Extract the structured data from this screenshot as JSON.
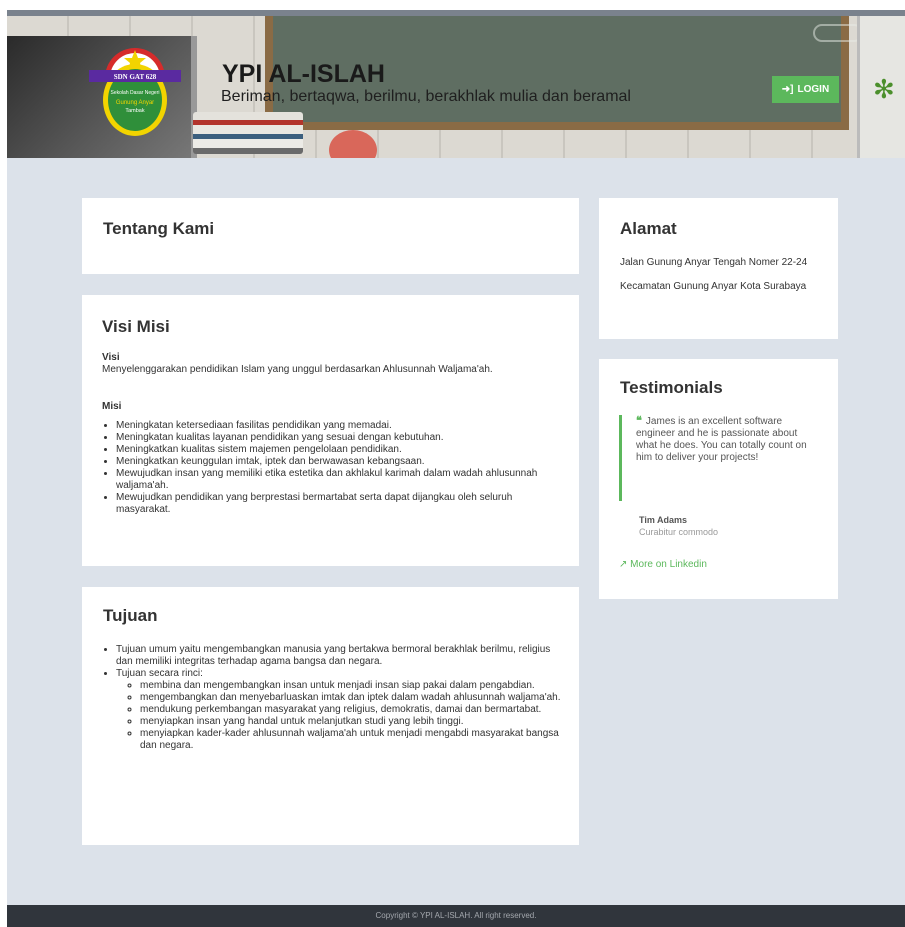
{
  "header": {
    "title": "YPI AL-ISLAH",
    "tagline": "Beriman, bertaqwa, berilmu, berakhlak mulia dan beramal",
    "login_label": "LOGIN",
    "logo": {
      "banner_text": "SDN GAT 628",
      "line1": "Sekolah Dasar Negeri",
      "line2": "Gunung Anyar",
      "line3": "Tambak"
    }
  },
  "tentang": {
    "title": "Tentang Kami"
  },
  "visi_misi": {
    "title": "Visi Misi",
    "visi_label": "Visi",
    "visi_text": "Menyelenggarakan pendidikan Islam yang unggul berdasarkan Ahlusunnah Waljama'ah.",
    "misi_label": "Misi",
    "misi_items": [
      "Meningkatan ketersediaan fasilitas pendidikan yang memadai.",
      "Meningkatan kualitas layanan pendidikan yang sesuai dengan kebutuhan.",
      "Meningkatkan kualitas sistem majemen pengelolaan pendidikan.",
      "Meningkatkan keunggulan imtak, iptek dan berwawasan kebangsaan.",
      "Mewujudkan insan yang memiliki etika estetika dan akhlakul karimah dalam wadah ahlusunnah waljama'ah.",
      "Mewujudkan pendidikan yang berprestasi bermartabat serta dapat dijangkau oleh seluruh masyarakat."
    ]
  },
  "tujuan": {
    "title": "Tujuan",
    "umum": "Tujuan umum yaitu mengembangkan manusia yang bertakwa bermoral berakhlak berilmu, religius dan memiliki integritas terhadap agama bangsa dan negara.",
    "rinci_label": "Tujuan secara rinci:",
    "rinci_items": [
      "membina dan mengembangkan insan untuk menjadi insan siap pakai dalam pengabdian.",
      "mengembangkan dan menyebarluaskan imtak dan iptek dalam wadah ahlusunnah waljama'ah.",
      "mendukung perkembangan masyarakat yang religius, demokratis, damai dan bermartabat.",
      "menyiapkan insan yang handal untuk melanjutkan studi yang lebih tinggi.",
      "menyiapkan kader-kader ahlusunnah waljama'ah untuk menjadi mengabdi masyarakat bangsa dan negara."
    ]
  },
  "alamat": {
    "title": "Alamat",
    "line1": "Jalan Gunung Anyar Tengah Nomer 22-24",
    "line2": "Kecamatan Gunung Anyar Kota Surabaya"
  },
  "testimonials": {
    "title": "Testimonials",
    "quote": "James is an excellent software engineer and he is passionate about what he does. You can totally count on him to deliver your projects!",
    "author": "Tim Adams",
    "role": "Curabitur commodo",
    "link": "More on Linkedin"
  },
  "footer": {
    "copyright": "Copyright © YPI AL-ISLAH. All right reserved."
  },
  "colors": {
    "accent": "#5cb85c",
    "background": "#dce2ea",
    "footer": "#30353c"
  }
}
